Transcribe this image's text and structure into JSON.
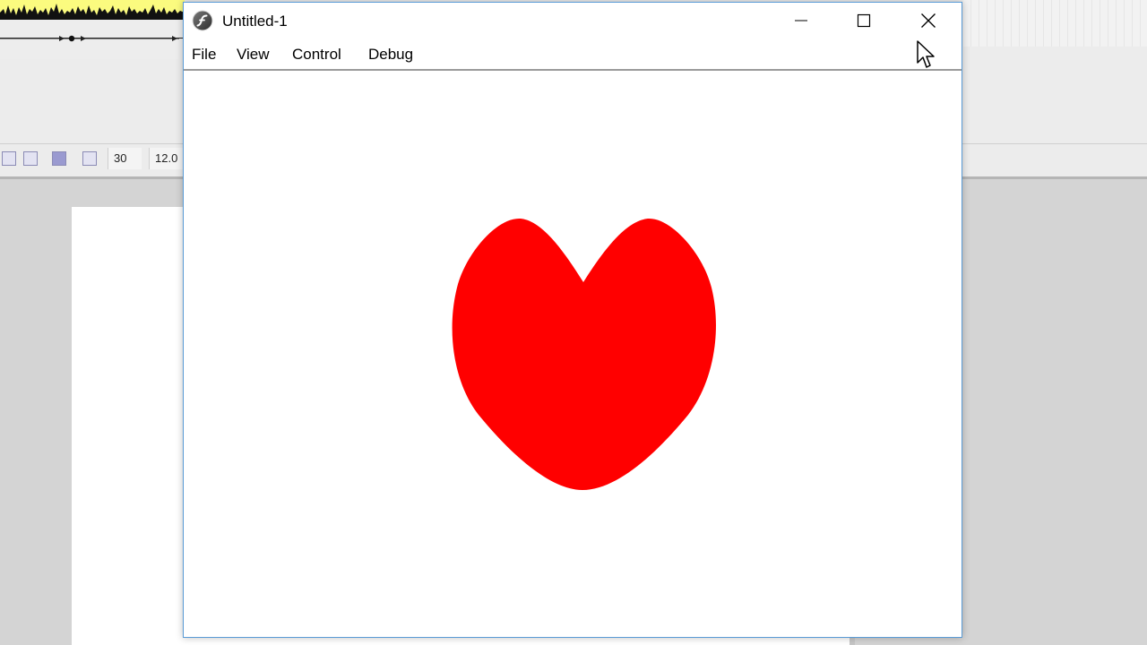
{
  "background_app": {
    "toolbar": {
      "fps_value": "30",
      "size_value": "12.0"
    }
  },
  "window": {
    "title": "Untitled-1",
    "icon": "flash-player-icon",
    "controls": {
      "minimize": "minimize-icon",
      "maximize": "maximize-icon",
      "close": "close-icon"
    }
  },
  "menubar": {
    "items": [
      {
        "label": "File"
      },
      {
        "label": "View"
      },
      {
        "label": "Control"
      },
      {
        "label": "Debug"
      }
    ]
  },
  "content": {
    "shape": "heart",
    "shape_color": "#ff0000",
    "background_color": "#ffffff"
  },
  "colors": {
    "window_border": "#5a9bd6",
    "waveform_bg": "#fbfb7f"
  }
}
